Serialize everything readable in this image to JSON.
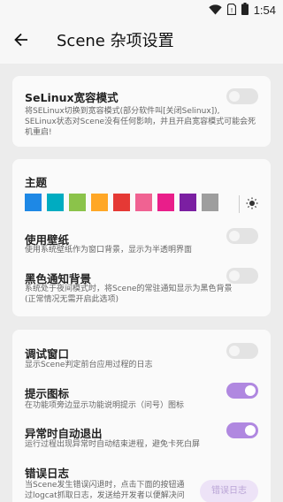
{
  "status": {
    "time": "1:54",
    "icons": [
      "wifi-icon",
      "sim-no-signal-icon",
      "battery-icon"
    ]
  },
  "appbar": {
    "title": "Scene 杂项设置",
    "back_icon": "arrow-back-icon"
  },
  "selinux": {
    "title": "SeLinux宽容模式",
    "desc_line1": "将SELinux切换到宽容模式(部分软件叫[关闭Selinux]),",
    "desc_line2": "SELinux状态对Scene没有任何影响，并且开启宽容模式可能会死机重启!",
    "enabled": false
  },
  "theme": {
    "title": "主题",
    "colors": [
      "#1e88e5",
      "#00acc1",
      "#8bc34a",
      "#ffa726",
      "#e53935",
      "#f06292",
      "#e91e8a",
      "#7b1fa2",
      "#9e9e9e"
    ],
    "light_mode_icon": "brightness-icon",
    "wallpaper": {
      "title": "使用壁纸",
      "desc": "使用系统壁纸作为窗口背景，显示为半透明界面",
      "enabled": false
    },
    "dark_notify": {
      "title": "黑色通知背景",
      "desc_line1": "系统处于夜间模式时，将Scene的常驻通知显示为黑色背景",
      "desc_line2": "(正常情况无需开启此选项)",
      "enabled": false
    }
  },
  "debug": {
    "debug_window": {
      "title": "调试窗口",
      "desc": "显示Scene判定前台应用过程的日志",
      "enabled": false
    },
    "hint_icon": {
      "title": "提示图标",
      "desc": "在功能项旁边显示功能说明提示（问号）图标",
      "enabled": true
    },
    "auto_exit": {
      "title": "异常时自动退出",
      "desc": "运行过程出现异常时自动结束进程，避免卡死白屏",
      "enabled": true
    },
    "error_log": {
      "title": "错误日志",
      "desc_line1": "当Scene发生错误闪退时，点击下面的按钮通",
      "desc_line2": "过logcat抓取日志，发送给开发者以便解决问",
      "button_label": "错误日志"
    }
  }
}
